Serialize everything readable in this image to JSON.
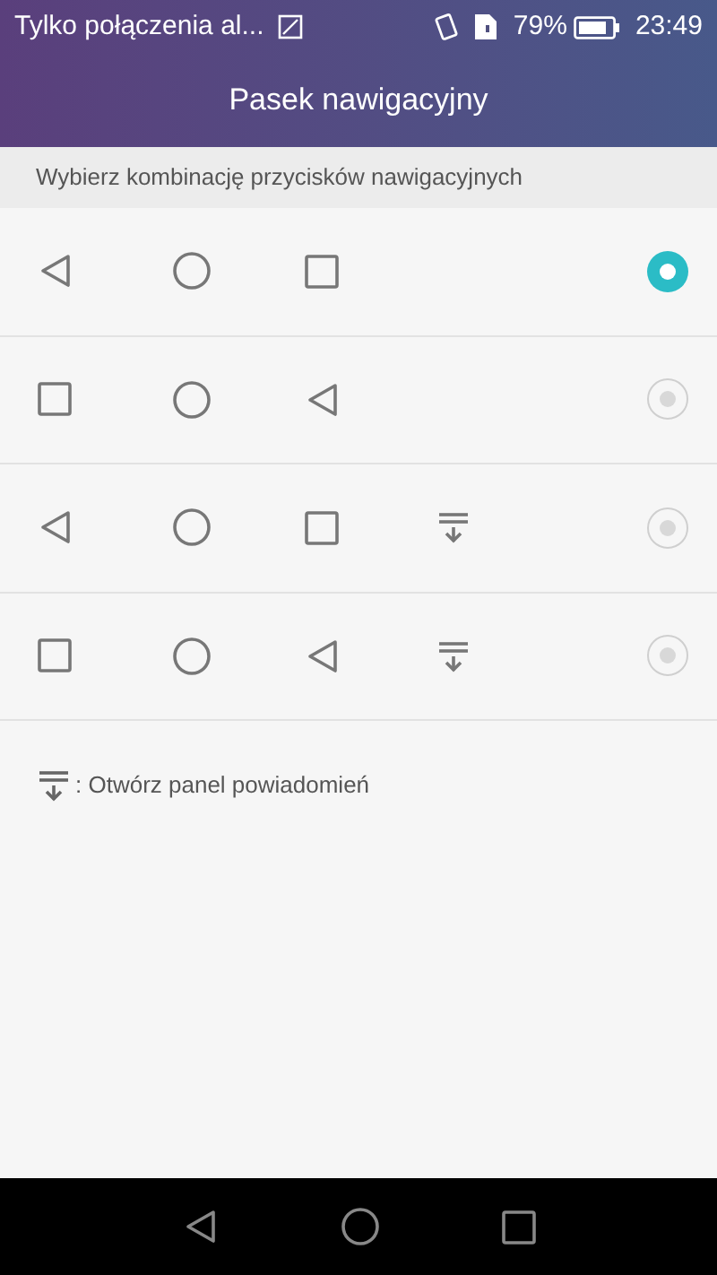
{
  "status_bar": {
    "carrier": "Tylko połączenia al...",
    "battery": "79%",
    "time": "23:49"
  },
  "title": "Pasek nawigacyjny",
  "section_header": "Wybierz kombinację przycisków nawigacyjnych",
  "options": [
    {
      "buttons": [
        {
          "kind": "back"
        },
        {
          "kind": "home"
        },
        {
          "kind": "recent"
        }
      ],
      "selected": true
    },
    {
      "buttons": [
        {
          "kind": "recent"
        },
        {
          "kind": "home"
        },
        {
          "kind": "back"
        }
      ],
      "selected": false
    },
    {
      "buttons": [
        {
          "kind": "back"
        },
        {
          "kind": "home"
        },
        {
          "kind": "recent"
        },
        {
          "kind": "notifications"
        }
      ],
      "selected": false
    },
    {
      "buttons": [
        {
          "kind": "recent"
        },
        {
          "kind": "home"
        },
        {
          "kind": "back"
        },
        {
          "kind": "notifications"
        }
      ],
      "selected": false
    }
  ],
  "legend": ": Otwórz panel powiadomień",
  "nav_bar": [
    {
      "kind": "back"
    },
    {
      "kind": "home"
    },
    {
      "kind": "recent"
    }
  ]
}
